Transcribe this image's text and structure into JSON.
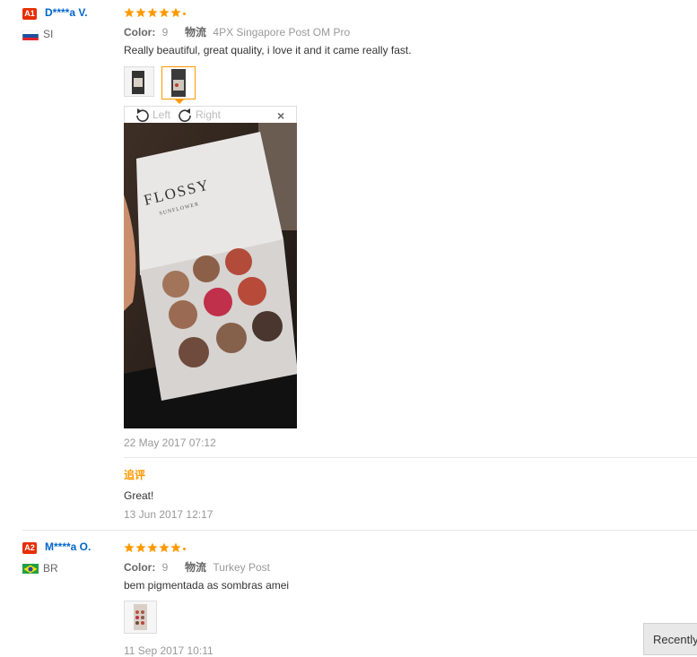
{
  "reviews": [
    {
      "level": "A1",
      "user": "D****a V.",
      "country": "SI",
      "color_label": "Color:",
      "color_value": "9",
      "logistics_label": "物流",
      "logistics_value": "4PX Singapore Post OM Pro",
      "text": "Really beautiful, great quality, i love it and it came really fast.",
      "date": "22 May 2017 07:12",
      "followup_label": "追评",
      "followup_text": "Great!",
      "followup_date": "13 Jun 2017 12:17"
    },
    {
      "level": "A2",
      "user": "M****a O.",
      "country": "BR",
      "color_label": "Color:",
      "color_value": "9",
      "logistics_label": "物流",
      "logistics_value": "Turkey Post",
      "text": "bem pigmentada as sombras amei",
      "date": "11 Sep 2017 10:11"
    }
  ],
  "viewer": {
    "rotate_left": "Left",
    "rotate_right": "Right",
    "close": "×",
    "palette_brand": "FLOSSY",
    "palette_sub": "SUNFLOWER"
  },
  "recently_button": "Recently",
  "colors": {
    "badge": "#e62e04",
    "star": "#ff9900",
    "username": "#0066cc",
    "followup": "#ff9900"
  }
}
